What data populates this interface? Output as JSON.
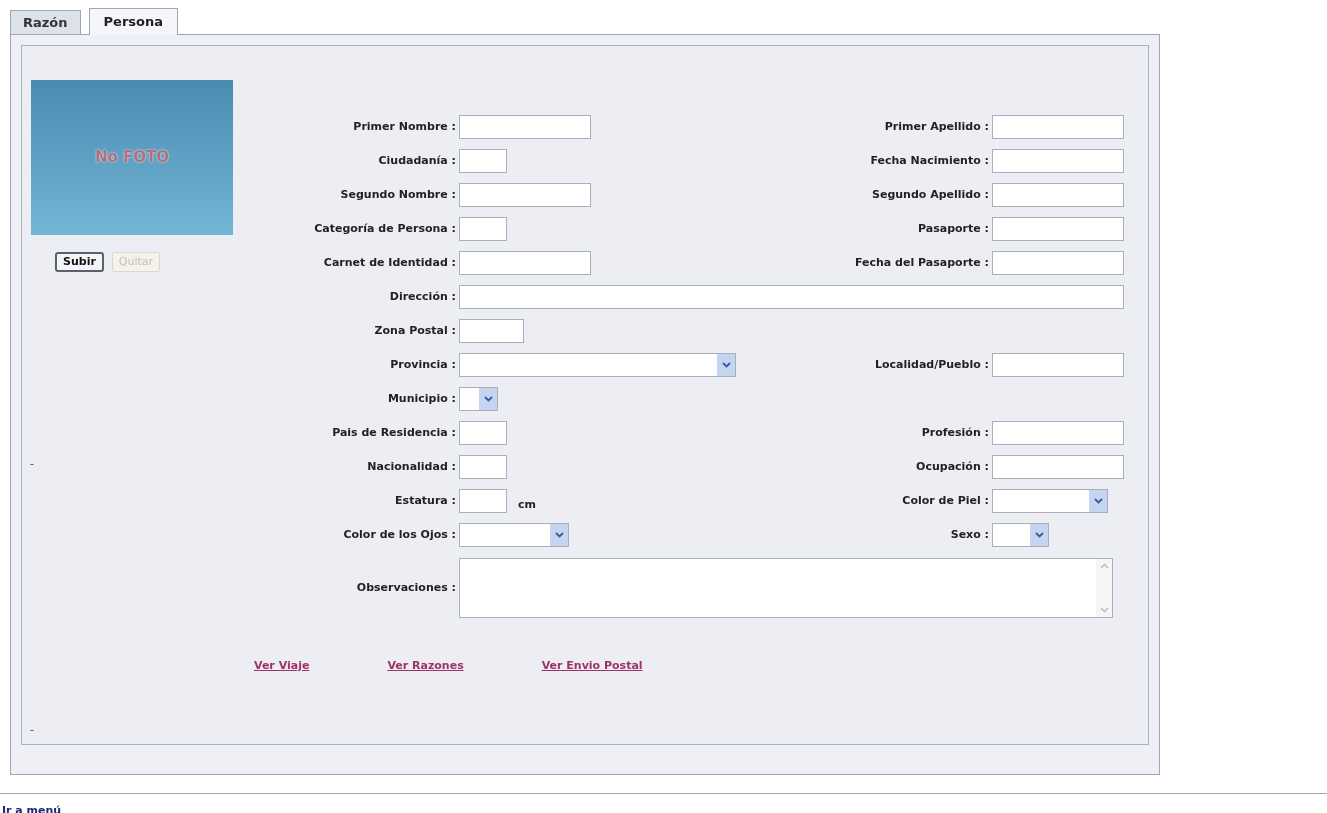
{
  "tabs": [
    {
      "label": "Razón",
      "selected": false
    },
    {
      "label": "Persona",
      "selected": true
    }
  ],
  "photo": {
    "caption": "No FOTO"
  },
  "photo_buttons": [
    {
      "label": "Subir",
      "disabled": false
    },
    {
      "label": "Quitar",
      "disabled": true
    }
  ],
  "rows": [
    {
      "left": {
        "label": "Primer Nombre :",
        "kind": "text"
      },
      "right": {
        "label": "Primer Apellido :",
        "kind": "text"
      }
    },
    {
      "left": {
        "label": "Ciudadanía :",
        "kind": "text"
      },
      "right": {
        "label": "Fecha Nacimiento :",
        "kind": "text"
      }
    },
    {
      "left": {
        "label": "Segundo Nombre :",
        "kind": "text"
      },
      "right": {
        "label": "Segundo Apellido :",
        "kind": "text"
      }
    },
    {
      "left": {
        "label": "Categoría de Persona :",
        "kind": "text"
      },
      "right": {
        "label": "Pasaporte :",
        "kind": "text"
      }
    },
    {
      "left": {
        "label": "Carnet de Identidad :",
        "kind": "text"
      },
      "right": {
        "label": "Fecha del Pasaporte :",
        "kind": "text"
      }
    },
    {
      "left": {
        "label": "Dirección :",
        "kind": "text"
      }
    },
    {
      "left": {
        "label": "Zona Postal :",
        "kind": "text"
      }
    },
    {
      "left": {
        "label": "Provincia :",
        "kind": "select"
      },
      "right": {
        "label": "Localidad/Pueblo :",
        "kind": "text"
      }
    },
    {
      "left": {
        "label": "Municipio :",
        "kind": "select"
      }
    },
    {
      "left": {
        "label": "Pais de Residencia :",
        "kind": "text"
      },
      "right": {
        "label": "Profesión :",
        "kind": "text"
      }
    },
    {
      "left": {
        "label": "Nacionalidad :",
        "kind": "text"
      },
      "right": {
        "label": "Ocupación :",
        "kind": "text"
      }
    },
    {
      "left": {
        "label": "Estatura :",
        "kind": "text",
        "unit": "cm"
      },
      "right": {
        "label": "Color de Piel :",
        "kind": "select"
      }
    },
    {
      "left": {
        "label": "Color de los Ojos :",
        "kind": "select"
      },
      "right": {
        "label": "Sexo :",
        "kind": "select"
      }
    },
    {
      "left": {
        "label": "Observaciones :",
        "kind": "textarea"
      }
    }
  ],
  "links": [
    "Ver Viaje",
    "Ver Razones",
    "Ver Envio Postal"
  ],
  "side_marks": [
    "-",
    "-"
  ],
  "footer_link": "Ir a menú"
}
